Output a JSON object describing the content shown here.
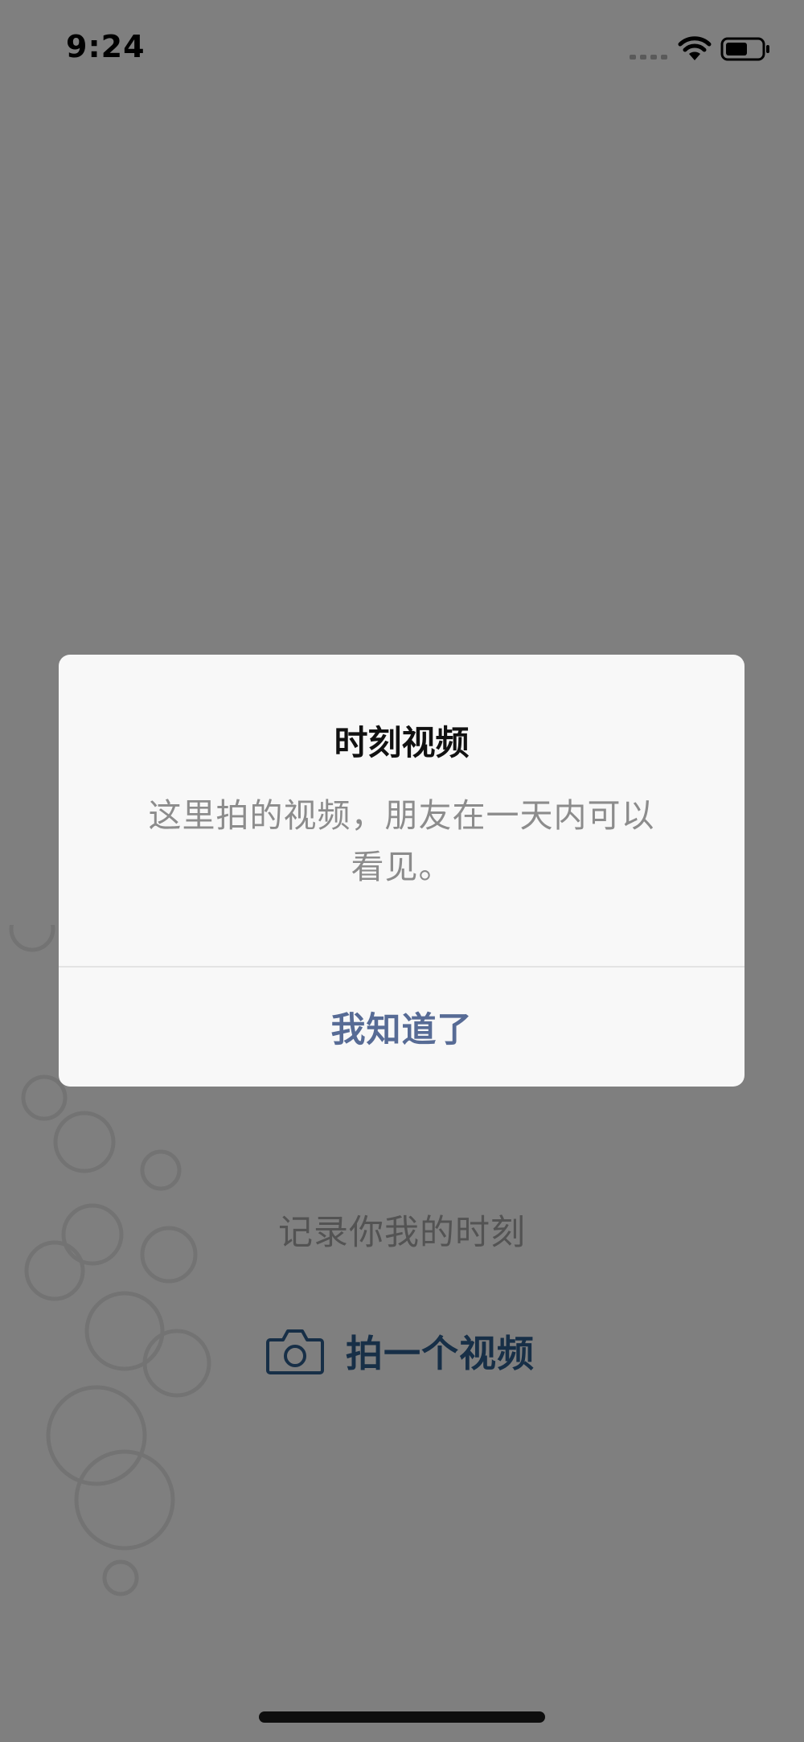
{
  "status_bar": {
    "time": "9:24"
  },
  "main": {
    "tagline": "记录你我的时刻",
    "shoot_button_label": "拍一个视频"
  },
  "dialog": {
    "title": "时刻视频",
    "message": "这里拍的视频，朋友在一天内可以看见。",
    "confirm_label": "我知道了"
  },
  "colors": {
    "link_blue": "#576b95",
    "action_blue": "#2f5f8e",
    "overlay": "rgba(0,0,0,0.5)"
  },
  "icons": {
    "shoot_button": "camera-icon",
    "status": [
      "cellular-signal-icon",
      "wifi-icon",
      "battery-icon"
    ]
  }
}
